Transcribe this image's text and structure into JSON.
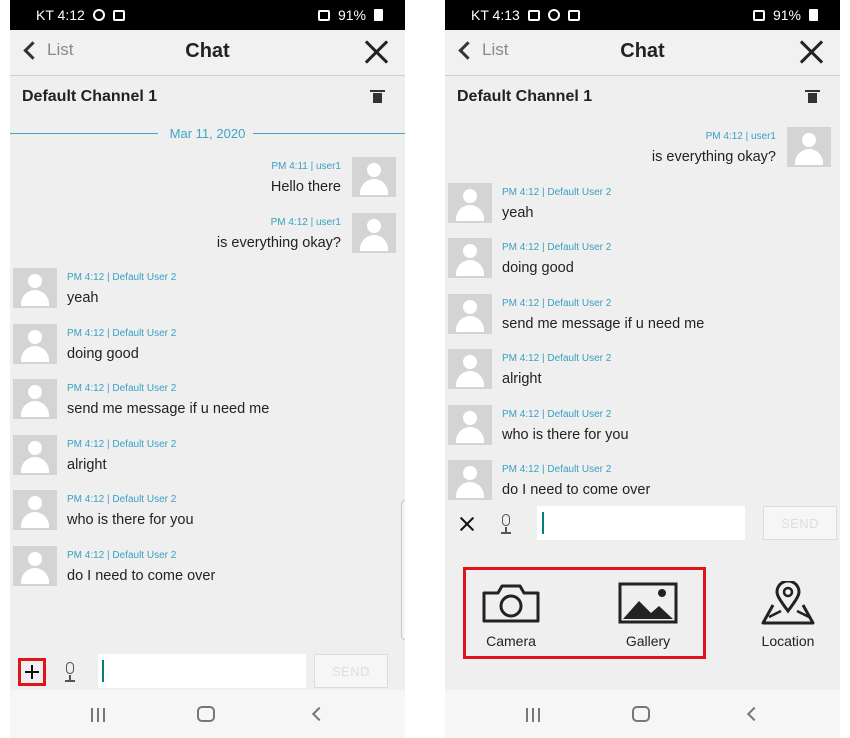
{
  "left": {
    "status": {
      "time": "KT 4:12",
      "battery": "91%"
    },
    "appbar": {
      "back_label": "List",
      "title": "Chat"
    },
    "channel": "Default Channel 1",
    "date_divider": "Mar 11, 2020",
    "messages": [
      {
        "meta": "PM 4:11 | user1",
        "text": "Hello there",
        "mine": true
      },
      {
        "meta": "PM 4:12 | user1",
        "text": "is everything okay?",
        "mine": true
      },
      {
        "meta": "PM 4:12 | Default User 2",
        "text": "yeah",
        "mine": false
      },
      {
        "meta": "PM 4:12 | Default User 2",
        "text": "doing good",
        "mine": false
      },
      {
        "meta": "PM 4:12 | Default User 2",
        "text": "send me message if u need me",
        "mine": false
      },
      {
        "meta": "PM 4:12 | Default User 2",
        "text": "alright",
        "mine": false
      },
      {
        "meta": "PM 4:12 | Default User 2",
        "text": "who is there for you",
        "mine": false
      },
      {
        "meta": "PM 4:12 | Default User 2",
        "text": "do I need to come over",
        "mine": false
      }
    ],
    "send_label": "SEND"
  },
  "right": {
    "status": {
      "time": "KT 4:13",
      "battery": "91%"
    },
    "appbar": {
      "back_label": "List",
      "title": "Chat"
    },
    "channel": "Default Channel 1",
    "messages": [
      {
        "meta": "PM 4:12 | user1",
        "text": "is everything okay?",
        "mine": true
      },
      {
        "meta": "PM 4:12 | Default User 2",
        "text": "yeah",
        "mine": false
      },
      {
        "meta": "PM 4:12 | Default User 2",
        "text": "doing good",
        "mine": false
      },
      {
        "meta": "PM 4:12 | Default User 2",
        "text": "send me message if u need me",
        "mine": false
      },
      {
        "meta": "PM 4:12 | Default User 2",
        "text": "alright",
        "mine": false
      },
      {
        "meta": "PM 4:12 | Default User 2",
        "text": "who is there for you",
        "mine": false
      },
      {
        "meta": "PM 4:12 | Default User 2",
        "text": "do I need to come over",
        "mine": false
      }
    ],
    "send_label": "SEND",
    "attach": {
      "camera": "Camera",
      "gallery": "Gallery",
      "location": "Location"
    }
  },
  "icons": {
    "back": "chevron-left-icon",
    "close": "close-icon",
    "trash": "trash-icon",
    "plus": "plus-icon",
    "mic": "microphone-icon",
    "camera": "camera-icon",
    "gallery": "gallery-icon",
    "location": "location-map-icon"
  },
  "colors": {
    "accent": "#41a6c5",
    "highlight": "#e0141b",
    "caret": "#0b7c79"
  }
}
